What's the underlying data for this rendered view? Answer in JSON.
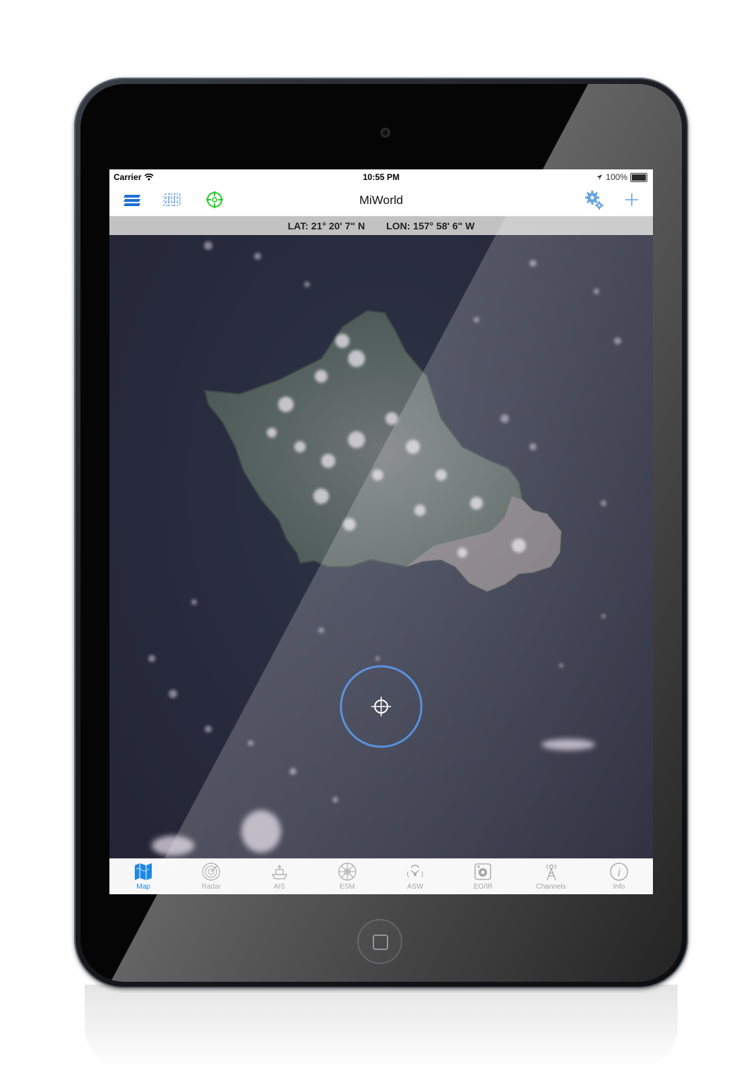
{
  "status": {
    "carrier": "Carrier",
    "time": "10:55 PM",
    "battery": "100%"
  },
  "nav": {
    "title": "MiWorld"
  },
  "coords": {
    "lat": "LAT: 21° 20' 7\" N",
    "lon": "LON: 157° 58' 6\" W"
  },
  "icons": {
    "layers": "layers-icon",
    "grid": "grid-overlay-icon",
    "locate": "locate-target-icon",
    "settings": "gears-icon",
    "add": "plus-icon",
    "crosshair": "crosshair-icon"
  },
  "colors": {
    "accent": "#1e88e5",
    "locate": "#22cc22",
    "ocean": "#272a3c",
    "land": "#5e6a6a"
  },
  "tabs": [
    {
      "label": "Map",
      "icon": "map-icon",
      "active": true
    },
    {
      "label": "Radar",
      "icon": "radar-icon",
      "active": false
    },
    {
      "label": "AIS",
      "icon": "ship-icon",
      "active": false
    },
    {
      "label": "ESM",
      "icon": "esm-wheel-icon",
      "active": false
    },
    {
      "label": "ASW",
      "icon": "sonar-icon",
      "active": false
    },
    {
      "label": "EO/IR",
      "icon": "camera-icon",
      "active": false
    },
    {
      "label": "Channels",
      "icon": "antenna-tower-icon",
      "active": false
    },
    {
      "label": "Info",
      "icon": "info-icon",
      "active": false
    }
  ]
}
